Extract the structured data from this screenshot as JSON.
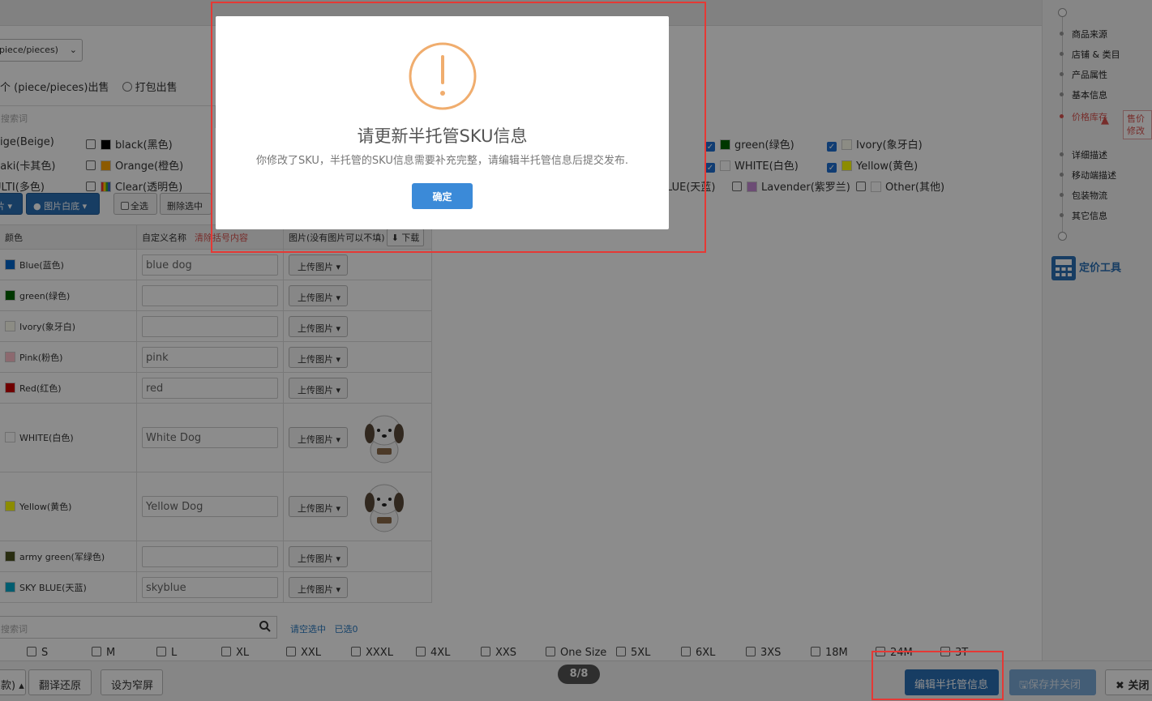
{
  "form": {
    "unit_select": "piece/pieces)",
    "sell_mode": {
      "option1": "个 (piece/pieces)出售",
      "option2": "打包出售"
    },
    "color_search_placeholder": "搜索词"
  },
  "colors": [
    {
      "label": "eige(Beige)",
      "checked": null,
      "swatch": ""
    },
    {
      "label": "black(黑色)",
      "checked": false,
      "swatch": "#000000"
    },
    {
      "label": "green(绿色)",
      "checked": true,
      "swatch": "#006400"
    },
    {
      "label": "Ivory(象牙白)",
      "checked": true,
      "swatch": "#fffff0"
    },
    {
      "label": "haki(卡其色)",
      "checked": null,
      "swatch": ""
    },
    {
      "label": "Orange(橙色)",
      "checked": false,
      "swatch": "#ffa500"
    },
    {
      "label": "WHITE(白色)",
      "checked": true,
      "swatch": "#ffffff"
    },
    {
      "label": "Yellow(黄色)",
      "checked": true,
      "swatch": "#ffff00"
    },
    {
      "label": "ULTI(多色)",
      "checked": null,
      "swatch": ""
    },
    {
      "label": "Clear(透明色)",
      "checked": false,
      "swatch": "multi"
    },
    {
      "label": "LUE(天蓝)",
      "checked": null,
      "swatch": ""
    },
    {
      "label": "Lavender(紫罗兰)",
      "checked": false,
      "swatch": "#c58ad6"
    },
    {
      "label": "Other(其他)",
      "checked": false,
      "swatch": "#ffffff"
    }
  ],
  "toolbar": {
    "btn_image": "片",
    "btn_white_bg": "图片白底",
    "btn_select_all": "全选",
    "btn_delete_selected": "删除选中"
  },
  "table": {
    "headers": {
      "color": "颜色",
      "custom_name": "自定义名称",
      "clear_brackets": "清除括号内容",
      "images": "图片(没有图片可以不填)",
      "download": "下载"
    },
    "upload_label": "上传图片",
    "rows": [
      {
        "color": "Blue(蓝色)",
        "swatch": "#0066cc",
        "value": "blue dog",
        "has_image": false
      },
      {
        "color": "green(绿色)",
        "swatch": "#006400",
        "value": "",
        "has_image": false
      },
      {
        "color": "Ivory(象牙白)",
        "swatch": "#fffff0",
        "value": "",
        "has_image": false
      },
      {
        "color": "Pink(粉色)",
        "swatch": "#ffc0cb",
        "value": "pink",
        "has_image": false
      },
      {
        "color": "Red(红色)",
        "swatch": "#cc0000",
        "value": "red",
        "has_image": false
      },
      {
        "color": "WHITE(白色)",
        "swatch": "#ffffff",
        "value": "White Dog",
        "has_image": true
      },
      {
        "color": "Yellow(黄色)",
        "swatch": "#ffff00",
        "value": "Yellow Dog",
        "has_image": true
      },
      {
        "color": "army green(军绿色)",
        "swatch": "#4b5320",
        "value": "",
        "has_image": false
      },
      {
        "color": "SKY BLUE(天蓝)",
        "swatch": "#00aacc",
        "value": "skyblue",
        "has_image": false
      }
    ]
  },
  "size": {
    "search_placeholder": "搜索词",
    "clear_selected": "请空选中",
    "selected_count": "已选0",
    "options": [
      "S",
      "M",
      "L",
      "XL",
      "XXL",
      "XXXL",
      "4XL",
      "XXS",
      "One Size",
      "5XL",
      "6XL",
      "3XS",
      "18M",
      "24M",
      "3T"
    ]
  },
  "footer": {
    "btn_left": "款)",
    "btn_translate_restore": "翻译还原",
    "btn_narrow": "设为窄屏",
    "pager": "8/8",
    "btn_edit_semi": "编辑半托管信息",
    "btn_save_close": "保存并关闭",
    "btn_close": "关闭"
  },
  "sidenav": {
    "items": [
      "商品来源",
      "店铺 & 类目",
      "产品属性",
      "基本信息",
      "价格库存",
      "详细描述",
      "移动端描述",
      "包装物流",
      "其它信息"
    ],
    "active_index": 4,
    "warn_text": "售价修改",
    "pricing_tool": "定价工具"
  },
  "modal": {
    "title": "请更新半托管SKU信息",
    "message": "你修改了SKU，半托管的SKU信息需要补充完整，请编辑半托管信息后提交发布.",
    "ok": "确定"
  },
  "colors_theme": {
    "primary": "#2a6fb5",
    "warning": "#f0ad6e",
    "danger": "#e53935"
  }
}
